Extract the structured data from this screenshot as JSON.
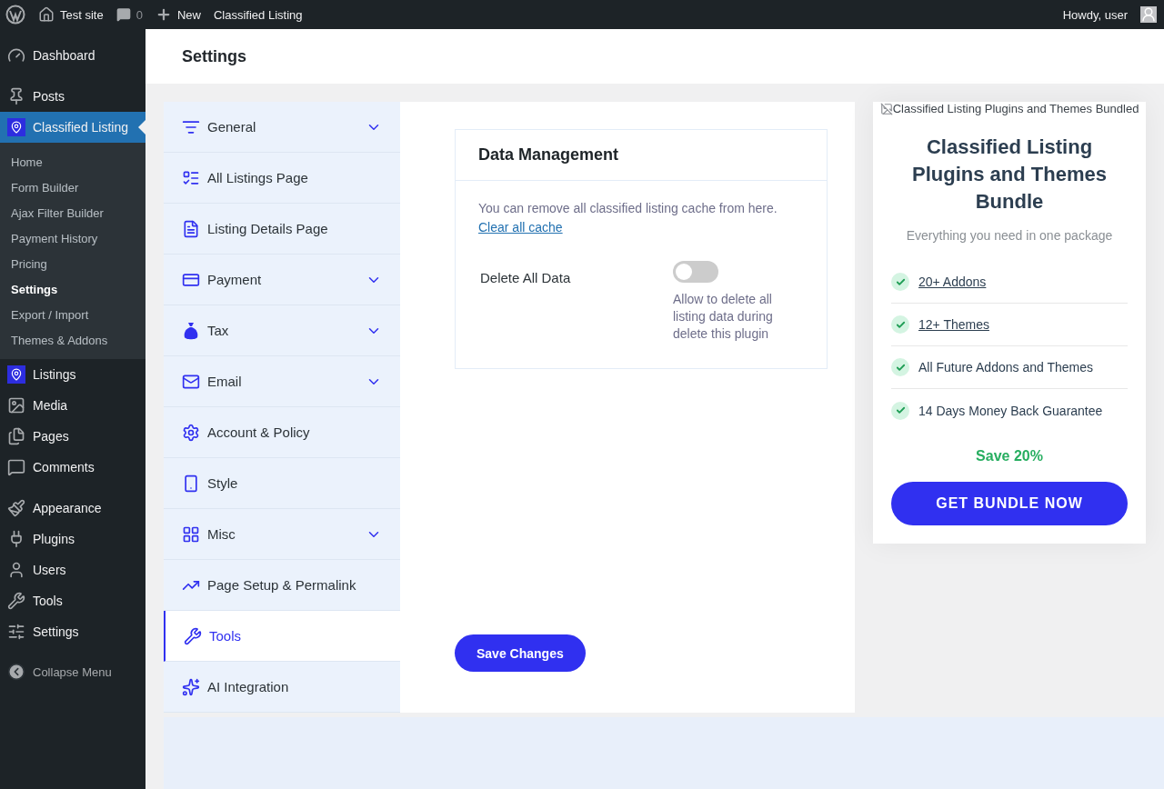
{
  "admin_bar": {
    "site": "Test site",
    "comments": "0",
    "new": "New",
    "plugin": "Classified Listing",
    "greeting": "Howdy, user"
  },
  "sidebar": {
    "groups": [
      {
        "items": [
          {
            "label": "Dashboard",
            "selected": false
          }
        ]
      },
      {
        "items": [
          {
            "label": "Posts",
            "selected": false
          },
          {
            "label": "Classified Listing",
            "selected": true,
            "children": [
              {
                "label": "Home",
                "selected": false
              },
              {
                "label": "Form Builder",
                "selected": false
              },
              {
                "label": "Ajax Filter Builder",
                "selected": false
              },
              {
                "label": "Payment History",
                "selected": false
              },
              {
                "label": "Pricing",
                "selected": false
              },
              {
                "label": "Settings",
                "selected": true
              },
              {
                "label": "Export / Import",
                "selected": false
              },
              {
                "label": "Themes & Addons",
                "selected": false
              }
            ]
          },
          {
            "label": "Listings",
            "selected": false
          },
          {
            "label": "Media",
            "selected": false
          },
          {
            "label": "Pages",
            "selected": false
          },
          {
            "label": "Comments",
            "selected": false
          }
        ]
      },
      {
        "items": [
          {
            "label": "Appearance",
            "selected": false
          },
          {
            "label": "Plugins",
            "selected": false
          },
          {
            "label": "Users",
            "selected": false
          },
          {
            "label": "Tools",
            "selected": false
          },
          {
            "label": "Settings",
            "selected": false
          }
        ]
      }
    ],
    "collapse": "Collapse Menu"
  },
  "page_title": "Settings",
  "settings_nav": [
    {
      "label": "General",
      "expandable": true,
      "selected": false
    },
    {
      "label": "All Listings Page",
      "expandable": false,
      "selected": false
    },
    {
      "label": "Listing Details Page",
      "expandable": false,
      "selected": false
    },
    {
      "label": "Payment",
      "expandable": true,
      "selected": false
    },
    {
      "label": "Tax",
      "expandable": true,
      "selected": false
    },
    {
      "label": "Email",
      "expandable": true,
      "selected": false
    },
    {
      "label": "Account & Policy",
      "expandable": false,
      "selected": false
    },
    {
      "label": "Style",
      "expandable": false,
      "selected": false
    },
    {
      "label": "Misc",
      "expandable": true,
      "selected": false
    },
    {
      "label": "Page Setup & Permalink",
      "expandable": false,
      "selected": false
    },
    {
      "label": "Tools",
      "expandable": false,
      "selected": true
    },
    {
      "label": "AI Integration",
      "expandable": false,
      "selected": false
    }
  ],
  "section": {
    "title": "Data Management",
    "description": "You can remove all classified listing cache from here.",
    "link": "Clear all cache",
    "toggle": {
      "label": "Delete All Data",
      "on": false,
      "help": "Allow to delete all listing data during delete this plugin"
    }
  },
  "save_button": "Save Changes",
  "promo": {
    "image_alt": "Classified Listing Plugins and Themes Bundled",
    "title": "Classified Listing Plugins and Themes Bundle",
    "subtitle": "Everything you need in one package",
    "features": [
      {
        "label": "20+ Addons",
        "link": true
      },
      {
        "label": "12+ Themes",
        "link": true
      },
      {
        "label": "All Future Addons and Themes",
        "link": false
      },
      {
        "label": "14 Days Money Back Guarantee",
        "link": false
      }
    ],
    "save": "Save 20%",
    "button": "GET BUNDLE NOW"
  }
}
